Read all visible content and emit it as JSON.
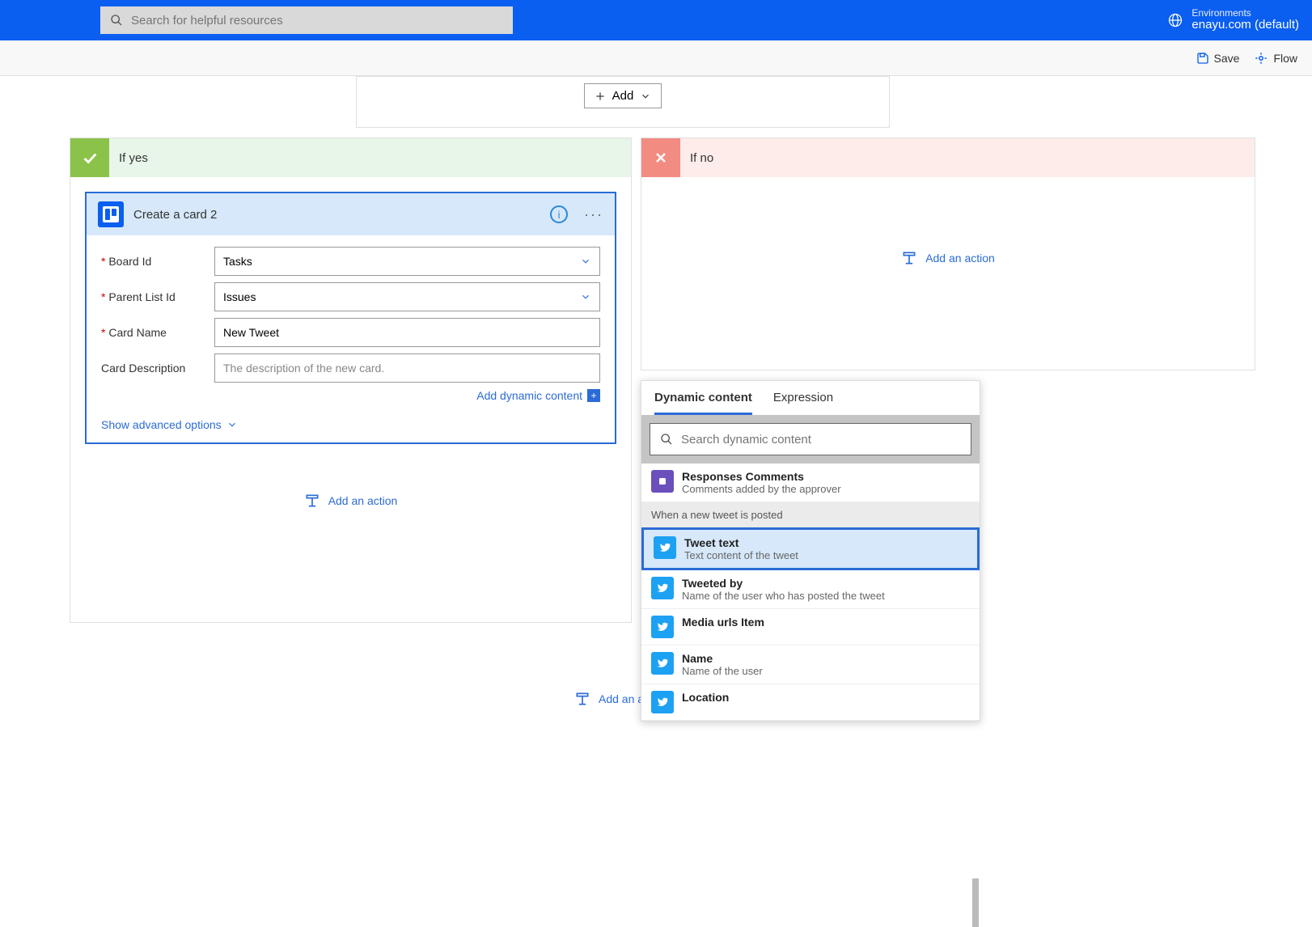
{
  "header": {
    "search_placeholder": "Search for helpful resources",
    "env_label": "Environments",
    "env_name": "enayu.com (default)"
  },
  "cmdbar": {
    "save": "Save",
    "flow": "Flow"
  },
  "addbox": {
    "add": "Add"
  },
  "yes": {
    "title": "If yes",
    "card_title": "Create a card 2",
    "board_label": "Board Id",
    "board_val": "Tasks",
    "list_label": "Parent List Id",
    "list_val": "Issues",
    "name_label": "Card Name",
    "name_val": "New Tweet",
    "desc_label": "Card Description",
    "desc_ph": "The description of the new card.",
    "dyn_link": "Add dynamic content",
    "adv": "Show advanced options",
    "add_action": "Add an action"
  },
  "no": {
    "title": "If no",
    "add_action": "Add an action"
  },
  "bottom_add": "Add an a",
  "dyn": {
    "tab1": "Dynamic content",
    "tab2": "Expression",
    "search_ph": "Search dynamic content",
    "resp_t": "Responses Comments",
    "resp_d": "Comments added by the approver",
    "section": "When a new tweet is posted",
    "items": [
      {
        "t": "Tweet text",
        "d": "Text content of the tweet"
      },
      {
        "t": "Tweeted by",
        "d": "Name of the user who has posted the tweet"
      },
      {
        "t": "Media urls Item",
        "d": ""
      },
      {
        "t": "Name",
        "d": "Name of the user"
      },
      {
        "t": "Location",
        "d": ""
      }
    ]
  }
}
